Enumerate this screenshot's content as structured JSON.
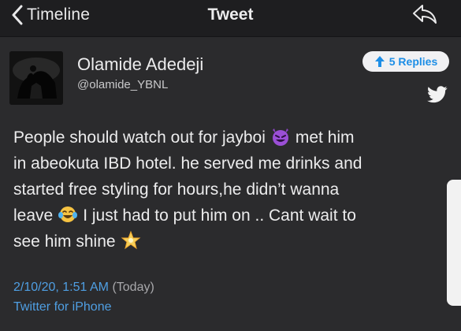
{
  "nav": {
    "back_label": "Timeline",
    "title": "Tweet",
    "back_icon": "chevron-left-icon",
    "share_icon": "share-arrow-icon"
  },
  "author": {
    "display_name": "Olamide Adedeji",
    "handle": "@olamide_YBNL",
    "avatar_icon": "avatar-silhouette-image"
  },
  "replies": {
    "label": "5 Replies",
    "icon": "arrow-up-icon"
  },
  "bird_icon": "twitter-bird-icon",
  "tweet": {
    "line1_a": "People should watch out for jayboi",
    "line1_b": "met him",
    "line2": "in abeokuta IBD hotel. he served me drinks and",
    "line3": "started free styling for hours,he didn’t wanna",
    "line4_a": "leave",
    "line4_b": "I just had to put him on .. Cant wait to",
    "line5": "see him shine",
    "emojis": [
      "smiling-devil-emoji",
      "tears-of-joy-emoji",
      "glowing-star-emoji"
    ]
  },
  "meta": {
    "date": "2/10/20, 1:51 AM",
    "relative": "(Today)",
    "source": "Twitter for iPhone"
  },
  "colors": {
    "background": "#2b2b2d",
    "nav_background": "#1e1e20",
    "link": "#4f9fe3",
    "accent": "#1d8ee6"
  }
}
